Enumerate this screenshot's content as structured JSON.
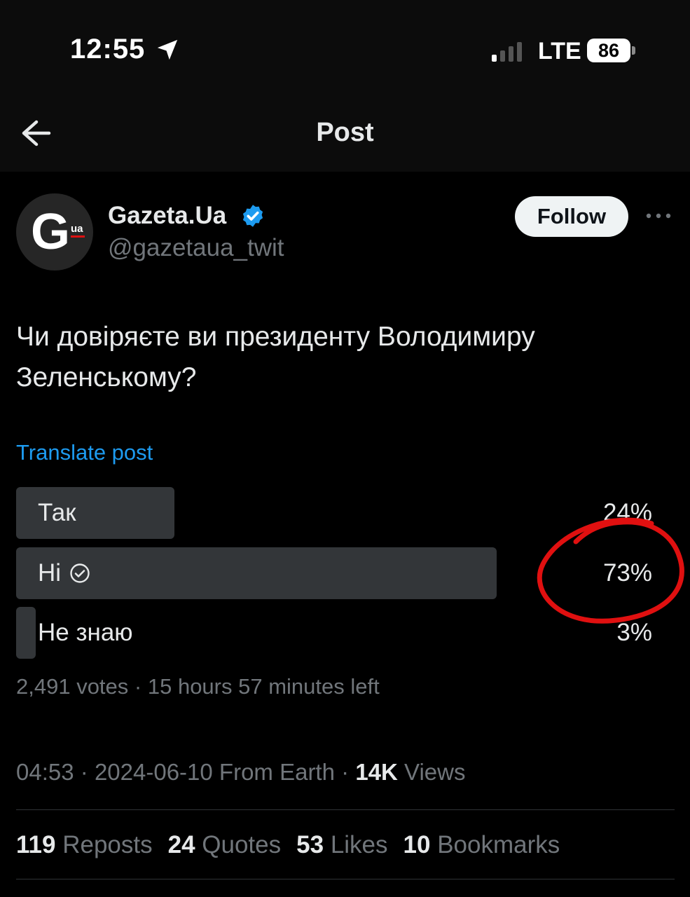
{
  "status_bar": {
    "time": "12:55",
    "network": "LTE",
    "battery": "86"
  },
  "nav": {
    "title": "Post"
  },
  "author": {
    "avatar_letter": "G",
    "avatar_sub": "ua",
    "display_name": "Gazeta.Ua",
    "handle": "@gazetaua_twit",
    "verified": true
  },
  "follow_label": "Follow",
  "post": {
    "text": "Чи довіряєте ви президенту Володимиру\nЗеленському?",
    "translate_label": "Translate post"
  },
  "poll": {
    "options": [
      {
        "label": "Так",
        "percent": "24%",
        "fill": 0.24
      },
      {
        "label": "Ні",
        "percent": "73%",
        "fill": 0.73,
        "selected": true
      },
      {
        "label": "Не знаю",
        "percent": "3%",
        "fill": 0.03
      }
    ],
    "votes": "2,491 votes",
    "time_left": "15 hours 57 minutes left"
  },
  "meta": {
    "time": "04:53",
    "date": "2024-06-10",
    "source": "From Earth",
    "views_count": "14K",
    "views_label": "Views"
  },
  "stats": {
    "reposts_count": "119",
    "reposts_label": "Reposts",
    "quotes_count": "24",
    "quotes_label": "Quotes",
    "likes_count": "53",
    "likes_label": "Likes",
    "bookmarks_count": "10",
    "bookmarks_label": "Bookmarks"
  },
  "colors": {
    "accent": "#1d9bf0",
    "poll_bar": "#333639",
    "annotation": "#e01010"
  }
}
